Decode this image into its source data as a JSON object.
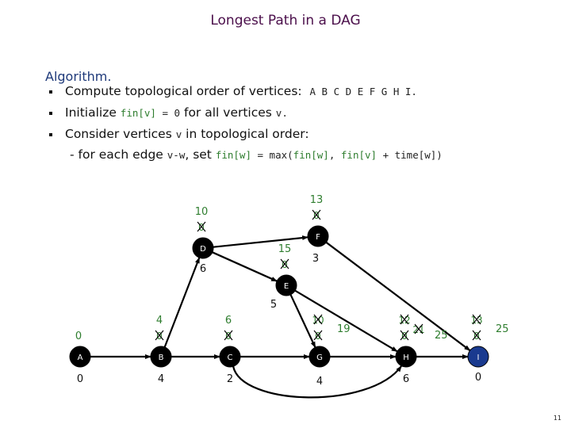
{
  "title": "Longest Path in a DAG",
  "algorithm_label": "Algorithm.",
  "steps": [
    {
      "text_a": "Compute topological order of vertices:",
      "code": "A B C D E F G H I."
    },
    {
      "text_a": "Initialize ",
      "code_green": "fin[v]",
      "code_b": " = 0",
      "text_b": " for all vertices ",
      "code_c": "v."
    },
    {
      "text_a": "Consider vertices ",
      "code": "v",
      "text_b": " in topological order:"
    }
  ],
  "substep": {
    "dash": "-",
    "text_a": "for each edge ",
    "code_a": "v-w",
    "text_b": ", set ",
    "code_green1": "fin[w]",
    "code_b": " = max(",
    "code_green2": "fin[w]",
    "code_c": ", ",
    "code_green3": "fin[v]",
    "code_d": " + time[w])"
  },
  "colors": {
    "node": "#000000",
    "node_highlight": "#1a3a8f",
    "fin_value": "#2e7d2e",
    "edge": "#000000"
  },
  "graph": {
    "nodes": [
      {
        "id": "A",
        "time": "0",
        "crossed": [],
        "fin": "0"
      },
      {
        "id": "B",
        "time": "4",
        "crossed": [
          "0"
        ],
        "fin": "4"
      },
      {
        "id": "C",
        "time": "2",
        "crossed": [
          "0"
        ],
        "fin": "6"
      },
      {
        "id": "D",
        "time": "6",
        "crossed": [
          "0"
        ],
        "fin": "10"
      },
      {
        "id": "E",
        "time": "5",
        "crossed": [
          "0"
        ],
        "fin": "15"
      },
      {
        "id": "F",
        "time": "3",
        "crossed": [
          "0"
        ],
        "fin": "13"
      },
      {
        "id": "G",
        "time": "4",
        "crossed": [
          "0",
          "10"
        ],
        "fin": "19"
      },
      {
        "id": "H",
        "time": "6",
        "crossed": [
          "0",
          "12",
          "21"
        ],
        "fin": "25"
      },
      {
        "id": "I",
        "time": "0",
        "crossed": [
          "0",
          "13"
        ],
        "fin": "25",
        "highlight": true
      }
    ],
    "edges": [
      [
        "A",
        "B"
      ],
      [
        "B",
        "C"
      ],
      [
        "B",
        "D"
      ],
      [
        "C",
        "G"
      ],
      [
        "C",
        "H"
      ],
      [
        "D",
        "F"
      ],
      [
        "D",
        "E"
      ],
      [
        "E",
        "G"
      ],
      [
        "E",
        "H"
      ],
      [
        "F",
        "I"
      ],
      [
        "G",
        "H"
      ],
      [
        "H",
        "I"
      ]
    ]
  },
  "page_number": "11"
}
